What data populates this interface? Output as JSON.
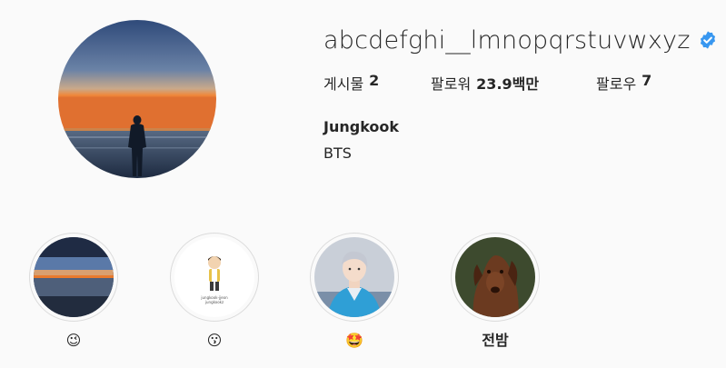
{
  "profile": {
    "username": "abcdefghi__lmnopqrstuvwxyz",
    "verified_icon": "verified-badge-icon",
    "full_name": "Jungkook",
    "bio": "BTS",
    "stats": {
      "posts_label": "게시물",
      "posts_value": "2",
      "followers_label": "팔로워",
      "followers_value": "23.9백만",
      "following_label": "팔로우",
      "following_value": "7"
    }
  },
  "highlights": [
    {
      "label": "😉",
      "thumb": "sunset-beach"
    },
    {
      "label": "😗",
      "thumb": "cartoon-character"
    },
    {
      "label": "🤩",
      "thumb": "person-blue-jacket"
    },
    {
      "label": "전밤",
      "thumb": "dog-portrait"
    }
  ],
  "highlight_thumb_texts": {
    "cartoon_line1": "jungkook-jjeon",
    "cartoon_line2": "jungkookz"
  },
  "colors": {
    "background": "#fafafa",
    "text": "#262626",
    "verified": "#3897f0",
    "ring": "#dbdbdb"
  }
}
